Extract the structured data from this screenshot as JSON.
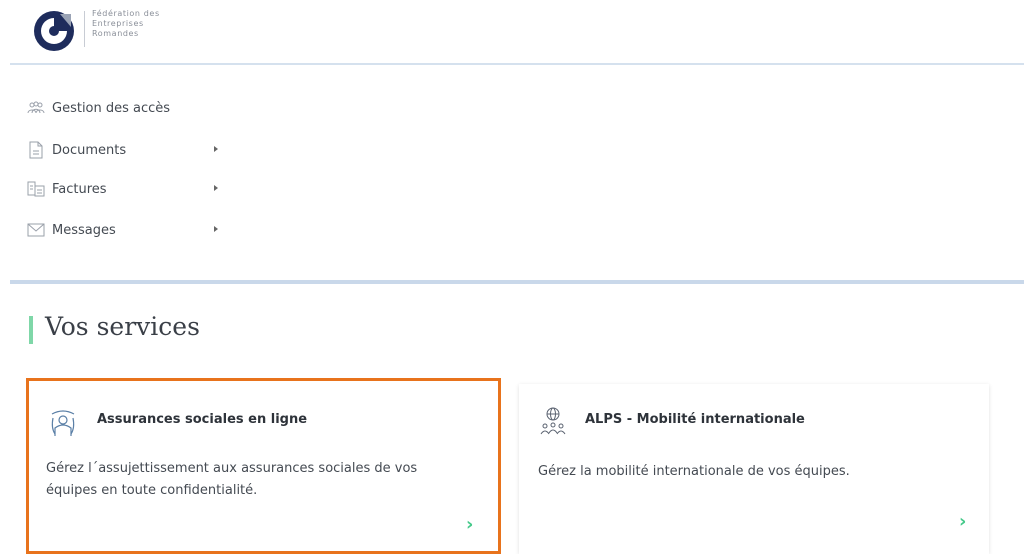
{
  "header": {
    "logo_lines": [
      "Fédération des",
      "Entreprises",
      "Romandes"
    ]
  },
  "menu": {
    "items": [
      {
        "label": "Gestion des accès",
        "icon": "users-icon",
        "has_submenu": false
      },
      {
        "label": "Documents",
        "icon": "document-icon",
        "has_submenu": true
      },
      {
        "label": "Factures",
        "icon": "invoices-icon",
        "has_submenu": true
      },
      {
        "label": "Messages",
        "icon": "envelope-icon",
        "has_submenu": true
      }
    ]
  },
  "services": {
    "title": "Vos services",
    "cards": [
      {
        "title": "Assurances sociales en ligne",
        "description": "Gérez l´assujettissement aux assurances sociales de vos équipes en toute confidentialité.",
        "icon": "social-insurance-icon",
        "selected": true
      },
      {
        "title": "ALPS - Mobilité internationale",
        "description": "Gérez la mobilité internationale de vos équipes.",
        "icon": "globe-people-icon",
        "selected": false
      }
    ],
    "arrow_glyph": "›"
  },
  "colors": {
    "accent_green": "#45c98a",
    "highlight_orange": "#e8731c",
    "logo_navy": "#1e2c5c",
    "divider_blue": "#c9d8ea"
  }
}
